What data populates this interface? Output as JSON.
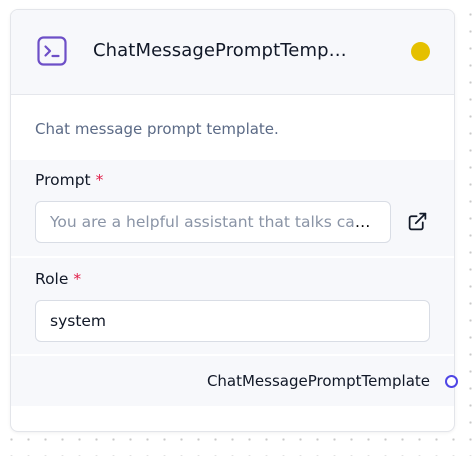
{
  "node": {
    "title": "ChatMessagePromptTemp…",
    "icon": "terminal-icon",
    "status_color": "#e5c000",
    "description": "Chat message prompt template."
  },
  "fields": {
    "prompt": {
      "label": "Prompt",
      "required_mark": "*",
      "placeholder": "You are a helpful assistant that talks casua…",
      "value": ""
    },
    "role": {
      "label": "Role",
      "required_mark": "*",
      "value": "system"
    }
  },
  "output": {
    "label": "ChatMessagePromptTemplate"
  },
  "colors": {
    "accent": "#6d4fc7",
    "handle": "#4f46e5",
    "required": "#e11d48"
  }
}
